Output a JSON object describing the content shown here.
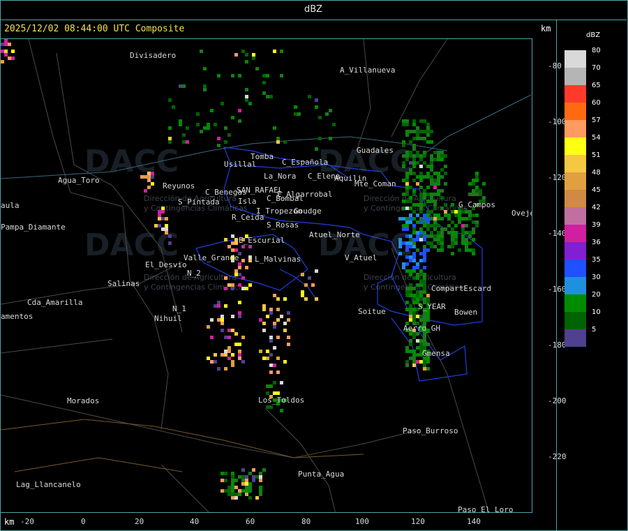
{
  "title": "dBZ",
  "header": "2025/12/02 08:44:00 UTC Composite",
  "axis_unit_top": "km",
  "axis_unit_bottom": "km",
  "y_ticks": [
    "-80",
    "-100",
    "-120",
    "-140",
    "-160",
    "-180",
    "-200",
    "-220"
  ],
  "x_ticks": [
    "-20",
    "0",
    "20",
    "40",
    "60",
    "80",
    "100",
    "120",
    "140"
  ],
  "legend": {
    "title": "dBZ",
    "labels": [
      "80",
      "70",
      "65",
      "60",
      "57",
      "54",
      "51",
      "48",
      "45",
      "42",
      "39",
      "36",
      "35",
      "30",
      "20",
      "10",
      "5"
    ],
    "colors": [
      "#d9d9d9",
      "#b5b5b5",
      "#ff3a2a",
      "#ff6a10",
      "#ff9a60",
      "#ffff14",
      "#f5c842",
      "#e0a040",
      "#d08a44",
      "#c070a0",
      "#d020a0",
      "#8020d0",
      "#2050ff",
      "#1f90e0",
      "#008c00",
      "#006400",
      "#504090"
    ]
  },
  "places": [
    {
      "name": "Divisadero"
    },
    {
      "name": "A_Villanueva"
    },
    {
      "name": "Guadales"
    },
    {
      "name": "Agua_Toro"
    },
    {
      "name": "Usillal"
    },
    {
      "name": "Tomba"
    },
    {
      "name": "La_Nora"
    },
    {
      "name": "C_Española"
    },
    {
      "name": "C_Elena"
    },
    {
      "name": "Aquilin"
    },
    {
      "name": "Mte_Coman"
    },
    {
      "name": "S_Pintada"
    },
    {
      "name": "Reyunos"
    },
    {
      "name": "C_Benegas"
    },
    {
      "name": "SAN_RAFAEL"
    },
    {
      "name": "E_Algarrobal"
    },
    {
      "name": "C_Bombal"
    },
    {
      "name": "Isla"
    },
    {
      "name": "I_Tropezon"
    },
    {
      "name": "Goudge"
    },
    {
      "name": "R_Ceida"
    },
    {
      "name": "S_Rosas"
    },
    {
      "name": "Atuel_Norte"
    },
    {
      "name": "E_Escurial"
    },
    {
      "name": "Valle_Grande"
    },
    {
      "name": "L_Malvinas"
    },
    {
      "name": "V_Atuel"
    },
    {
      "name": "El_Desvio"
    },
    {
      "name": "Salinas"
    },
    {
      "name": "N_2"
    },
    {
      "name": "N_1"
    },
    {
      "name": "Nihuil"
    },
    {
      "name": "CompartEscard"
    },
    {
      "name": "Bowen"
    },
    {
      "name": "Soitue"
    },
    {
      "name": "S_YEAR"
    },
    {
      "name": "Aerro_GH"
    },
    {
      "name": "Gmensa"
    },
    {
      "name": "Los_Toldos"
    },
    {
      "name": "Morados"
    },
    {
      "name": "Paso_Burroso"
    },
    {
      "name": "Punta_Agua"
    },
    {
      "name": "Lag_Llancanelo"
    },
    {
      "name": "Paso_El_Loro"
    },
    {
      "name": "Pampa_Diamante"
    },
    {
      "name": "Cda_Amarilla"
    },
    {
      "name": "amentos"
    },
    {
      "name": "aula"
    },
    {
      "name": "G_Campos"
    },
    {
      "name": "Ovejer"
    }
  ],
  "watermark": {
    "brand": "DACC",
    "subtitle1": "Dirección de Agricultura",
    "subtitle2": "y Contingencias Climáticas"
  }
}
